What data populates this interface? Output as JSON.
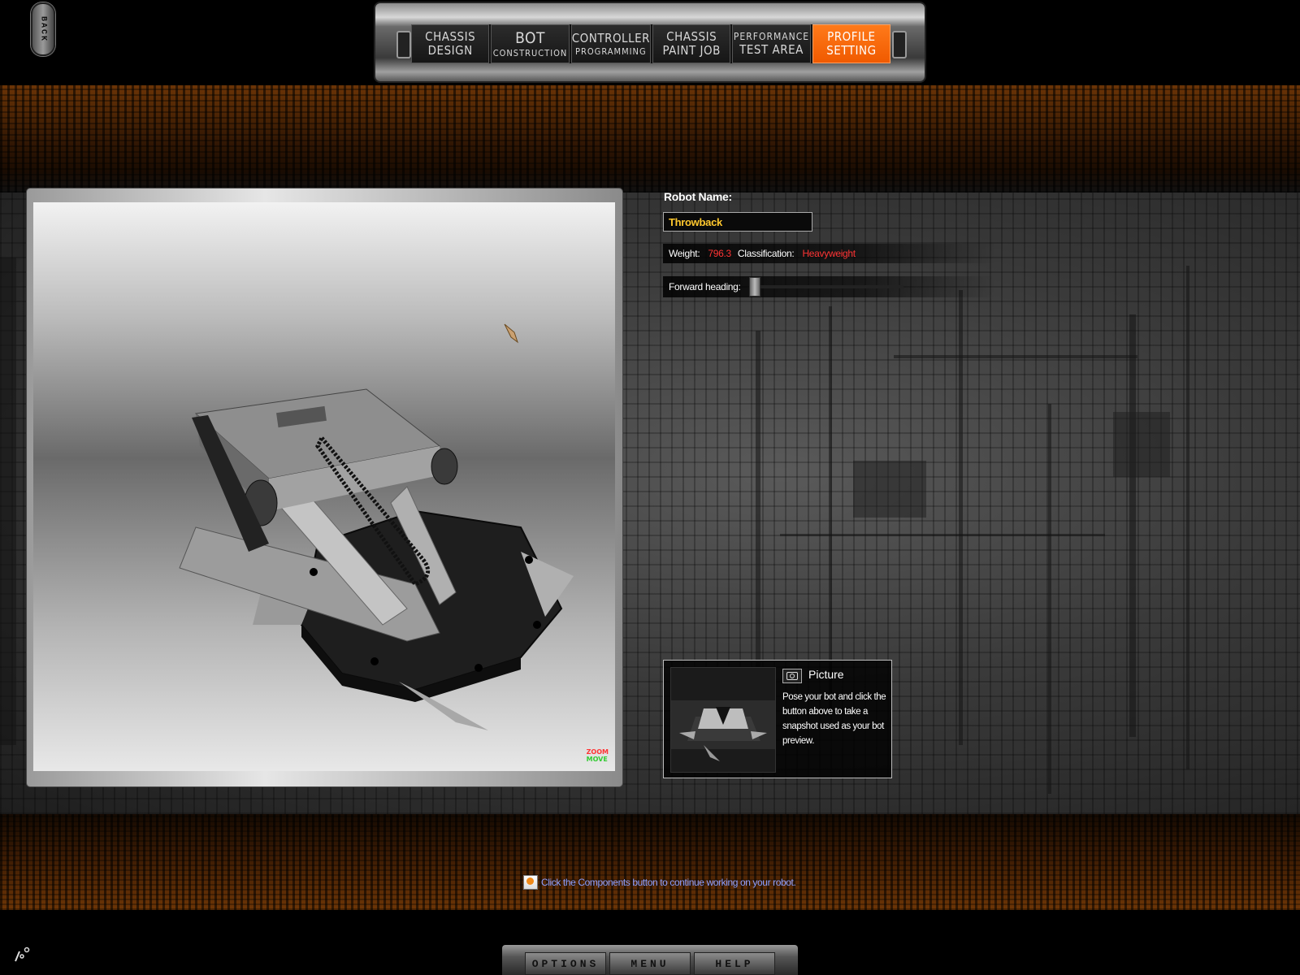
{
  "back_button": {
    "label": "BACK"
  },
  "nav": {
    "tabs": [
      {
        "line1": "CHASSIS",
        "line2": "DESIGN",
        "style": "normal",
        "active": false
      },
      {
        "line1": "BOT",
        "line2": "CONSTRUCTION",
        "style": "big",
        "active": false
      },
      {
        "line1": "CONTROLLER",
        "line2": "PROGRAMMING",
        "style": "normal",
        "active": false
      },
      {
        "line1": "CHASSIS",
        "line2": "PAINT JOB",
        "style": "normal",
        "active": false
      },
      {
        "line1": "PERFORMANCE",
        "line2": "TEST AREA",
        "style": "normal",
        "active": false
      },
      {
        "line1": "PROFILE",
        "line2": "SETTING",
        "style": "normal",
        "active": true
      }
    ]
  },
  "profile": {
    "robot_name_label": "Robot Name:",
    "robot_name_value": "Throwback",
    "weight_label": "Weight:",
    "weight_value": "796.3",
    "classification_label": "Classification:",
    "classification_value": "Heavyweight",
    "forward_heading_label": "Forward heading:",
    "forward_heading_level": 0
  },
  "viewport": {
    "zoom_label": "ZOOM",
    "move_label": "MOVE"
  },
  "picture": {
    "title": "Picture",
    "description": "Pose your bot and click the button above to take a snapshot used as your bot preview."
  },
  "tip": {
    "text": "Click the Components button to continue working on your robot."
  },
  "bottom_menu": {
    "options": "OPTIONS",
    "menu": "MENU",
    "help": "HELP"
  },
  "colors": {
    "accent": "#f05a00",
    "name_value": "#ffc82e",
    "stat_value": "#ff3434",
    "tip_text": "#8fa0ff"
  },
  "icons": {
    "camera": "camera-icon",
    "tip": "tip-icon",
    "zoom": "zoom-icon",
    "corner": "settings-glyph-icon"
  }
}
